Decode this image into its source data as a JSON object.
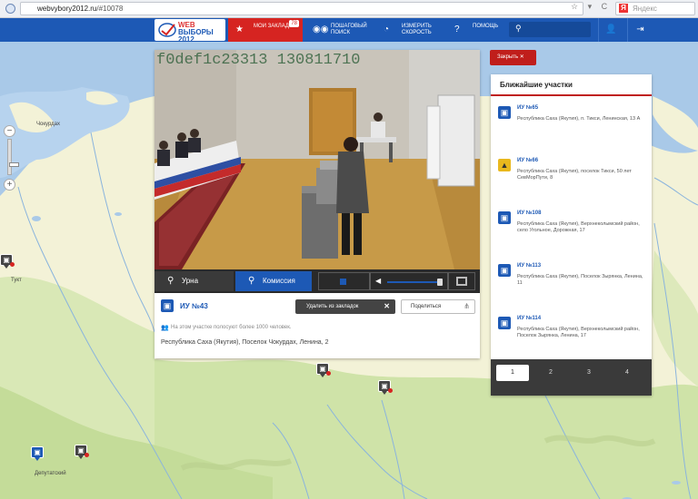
{
  "browser": {
    "url_domain": "webvybory2012.ru",
    "url_path": "/#10078",
    "search_placeholder": "Яндекс",
    "url_icons": "☆ ▾ C"
  },
  "header": {
    "logo_line1": "WEB",
    "logo_line2": "ВЫБОРЫ",
    "logo_line3": "2012",
    "nav": {
      "bookmarks_label": "Мои закладки",
      "bookmarks_count": "78",
      "search_label": "Пошаговый поиск",
      "speed_label": "Измерить скорость",
      "help_label": "Помощь"
    }
  },
  "map": {
    "places": {
      "chokurdakh": "Чокурдах",
      "tuktu": "Тукт",
      "deputatsky": "Депутатский"
    }
  },
  "video": {
    "camera_id": "f0def1c23313 130811710",
    "cam_urn_label": "Урна",
    "cam_commission_label": "Комиссия"
  },
  "station": {
    "title": "ИУ №43",
    "remove_bookmark_label": "Удалить из закладок",
    "share_label": "Поделиться",
    "count_text": "На этом участке полосуют более 1000 человек.",
    "address": "Республика Саха (Якутия), Поселок Чокурдах, Ленина, 2"
  },
  "close_label": "Закрыть ✕",
  "nearest": {
    "title": "Ближайшие участки",
    "items": [
      {
        "title": "ИУ №65",
        "address": "Республика Саха (Якутия), п. Тикси, Ленинская, 13 А",
        "color": "blue"
      },
      {
        "title": "ИУ №66",
        "address": "Республика Саха (Якутия), поселок Тикси, 50 лет СевМорПути, 8",
        "color": "yellow"
      },
      {
        "title": "ИУ №108",
        "address": "Республика Саха (Якутия), Верхнеколымский район, село Угольное, Дорожная, 17",
        "color": "blue"
      },
      {
        "title": "ИУ №113",
        "address": "Республика Саха (Якутия), Поселок Зырянка, Ленина, 11",
        "color": "blue"
      },
      {
        "title": "ИУ №114",
        "address": "Республика Саха (Якутия), Верхнеколымский район, Поселок Зырянка, Ленина, 17",
        "color": "blue"
      }
    ],
    "pages": [
      "1",
      "2",
      "3",
      "4"
    ],
    "active_page": "1"
  },
  "colors": {
    "brand_blue": "#1d59b5",
    "accent_red": "#d62421",
    "warning_yellow": "#e9b81e"
  }
}
